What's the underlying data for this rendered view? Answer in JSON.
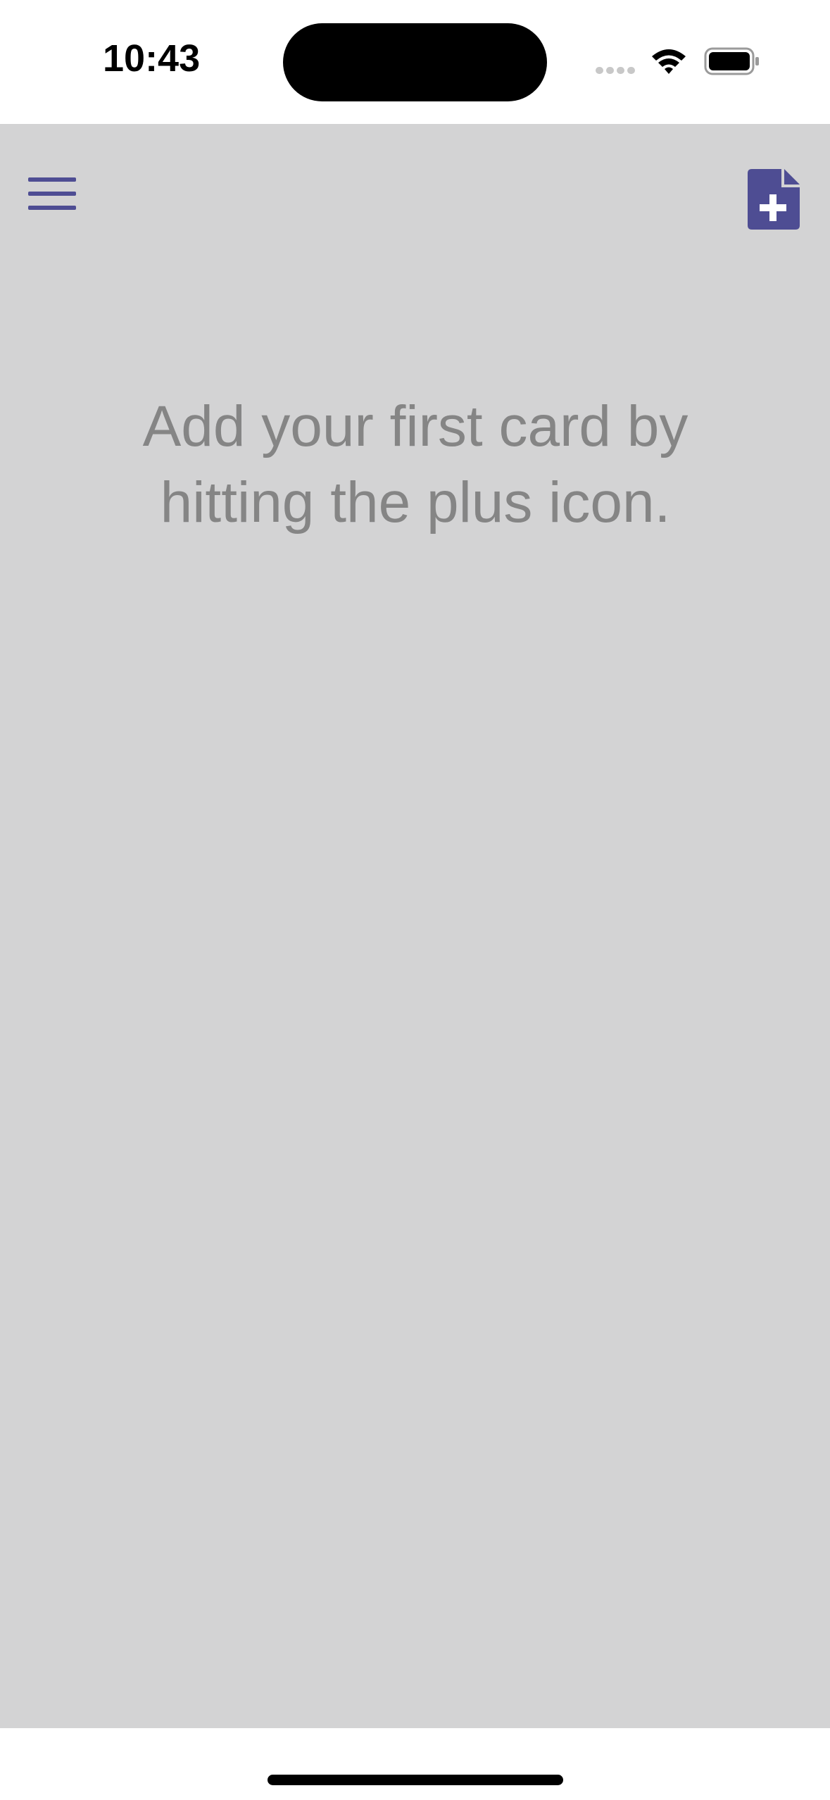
{
  "status_bar": {
    "time": "10:43"
  },
  "colors": {
    "accent": "#4e4d93",
    "background": "#d3d3d4",
    "message_text": "#858585"
  },
  "icons": {
    "menu": "hamburger-menu-icon",
    "add_card": "file-plus-icon"
  },
  "main": {
    "empty_message": "Add your first card by hitting the plus icon."
  }
}
